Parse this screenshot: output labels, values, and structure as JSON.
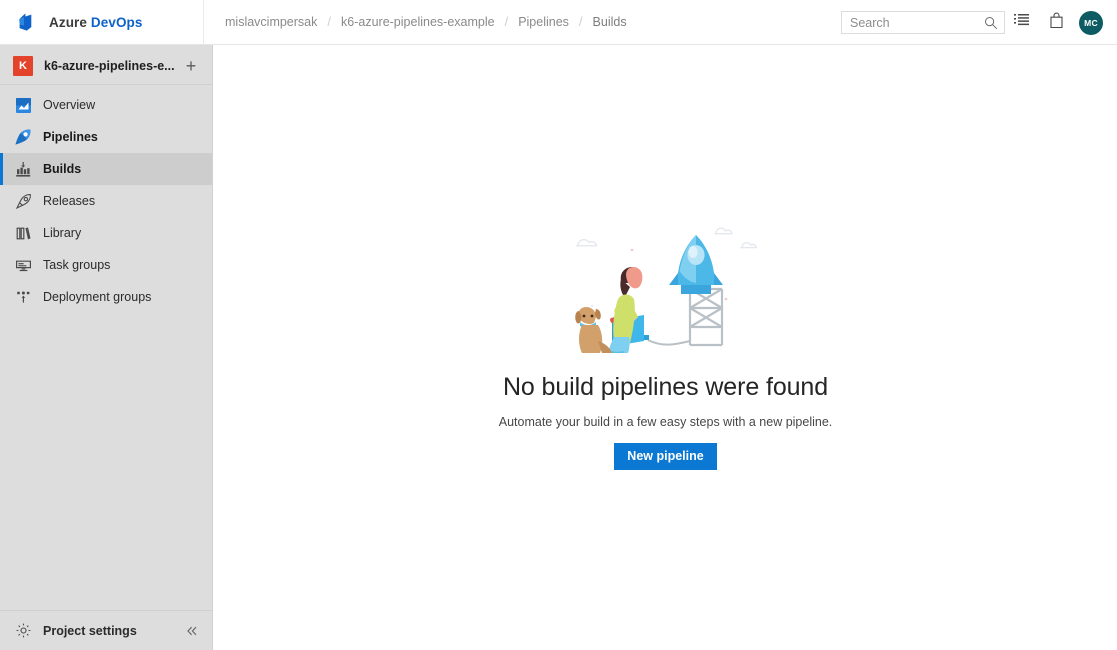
{
  "topbar": {
    "logo_icon": "azure-devops-logo-icon",
    "brand_first": "Azure",
    "brand_second": "DevOps",
    "breadcrumb": [
      {
        "label": "mislavcimpersak"
      },
      {
        "label": "k6-azure-pipelines-example"
      },
      {
        "label": "Pipelines"
      },
      {
        "label": "Builds"
      }
    ],
    "separator": "/",
    "search": {
      "placeholder": "Search",
      "value": "",
      "icon": "search-icon"
    },
    "icons": [
      {
        "name": "backlog-list-icon"
      },
      {
        "name": "marketplace-bag-icon"
      }
    ],
    "avatar": {
      "initials": "MC",
      "color": "#0d5c63"
    }
  },
  "sidebar": {
    "project": {
      "initial": "K",
      "name": "k6-azure-pipelines-e...",
      "avatar_color": "#e2432a",
      "add_label": "+"
    },
    "items": [
      {
        "label": "Overview",
        "icon": "overview-dashboard-icon",
        "selected": false,
        "bold": false
      },
      {
        "label": "Pipelines",
        "icon": "pipelines-rocket-icon",
        "selected": false,
        "bold": true
      },
      {
        "label": "Builds",
        "icon": "builds-icon",
        "selected": true,
        "bold": true
      },
      {
        "label": "Releases",
        "icon": "releases-rocket-icon",
        "selected": false,
        "bold": false
      },
      {
        "label": "Library",
        "icon": "library-books-icon",
        "selected": false,
        "bold": false
      },
      {
        "label": "Task groups",
        "icon": "task-groups-icon",
        "selected": false,
        "bold": false
      },
      {
        "label": "Deployment groups",
        "icon": "deployment-groups-icon",
        "selected": false,
        "bold": false
      }
    ],
    "footer": {
      "label": "Project settings",
      "icon": "gear-icon",
      "collapse_icon": "chevron-double-left-icon"
    },
    "accent_color": "#0b77d4"
  },
  "main": {
    "illustration": "rocket-launch-illustration",
    "title": "No build pipelines were found",
    "subtitle": "Automate your build in a few easy steps with a new pipeline.",
    "button_label": "New pipeline",
    "button_color": "#0b78d4"
  }
}
